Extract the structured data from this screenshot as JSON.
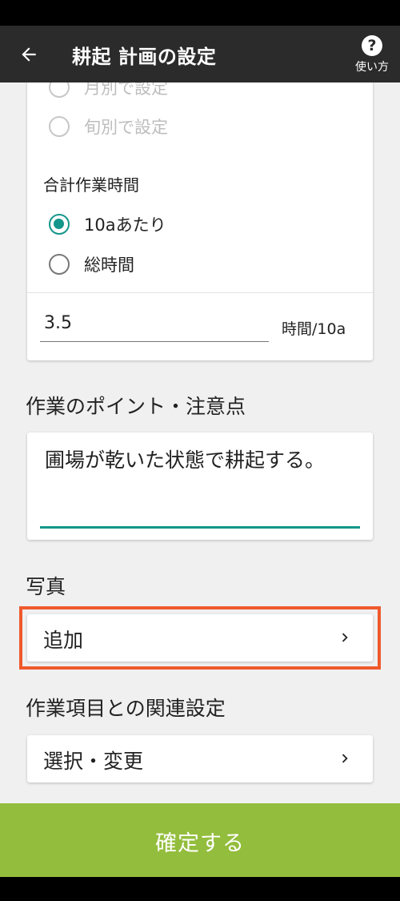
{
  "app_bar": {
    "title": "耕起 計画の設定",
    "help_glyph": "?",
    "help_label": "使い方"
  },
  "settings": {
    "period_options": [
      {
        "label": "月別で設定",
        "selected": false,
        "enabled": false
      },
      {
        "label": "旬別で設定",
        "selected": false,
        "enabled": false
      }
    ],
    "total_time_label": "合計作業時間",
    "total_time_options": [
      {
        "label": "10aあたり",
        "selected": true
      },
      {
        "label": "総時間",
        "selected": false
      }
    ],
    "hours_value": "3.5",
    "hours_unit": "時間/10a"
  },
  "notes": {
    "title": "作業のポイント・注意点",
    "text": "圃場が乾いた状態で耕起する。"
  },
  "photo": {
    "title": "写真",
    "add_label": "追加"
  },
  "related": {
    "title": "作業項目との関連設定",
    "select_label": "選択・変更"
  },
  "confirm_label": "確定する",
  "colors": {
    "accent": "#14968a",
    "confirm": "#93bd3c",
    "highlight": "#ef5a2b",
    "app_bar": "#2b2b2b"
  },
  "icons": [
    "back-arrow-icon",
    "help-icon",
    "chevron-right-icon"
  ]
}
